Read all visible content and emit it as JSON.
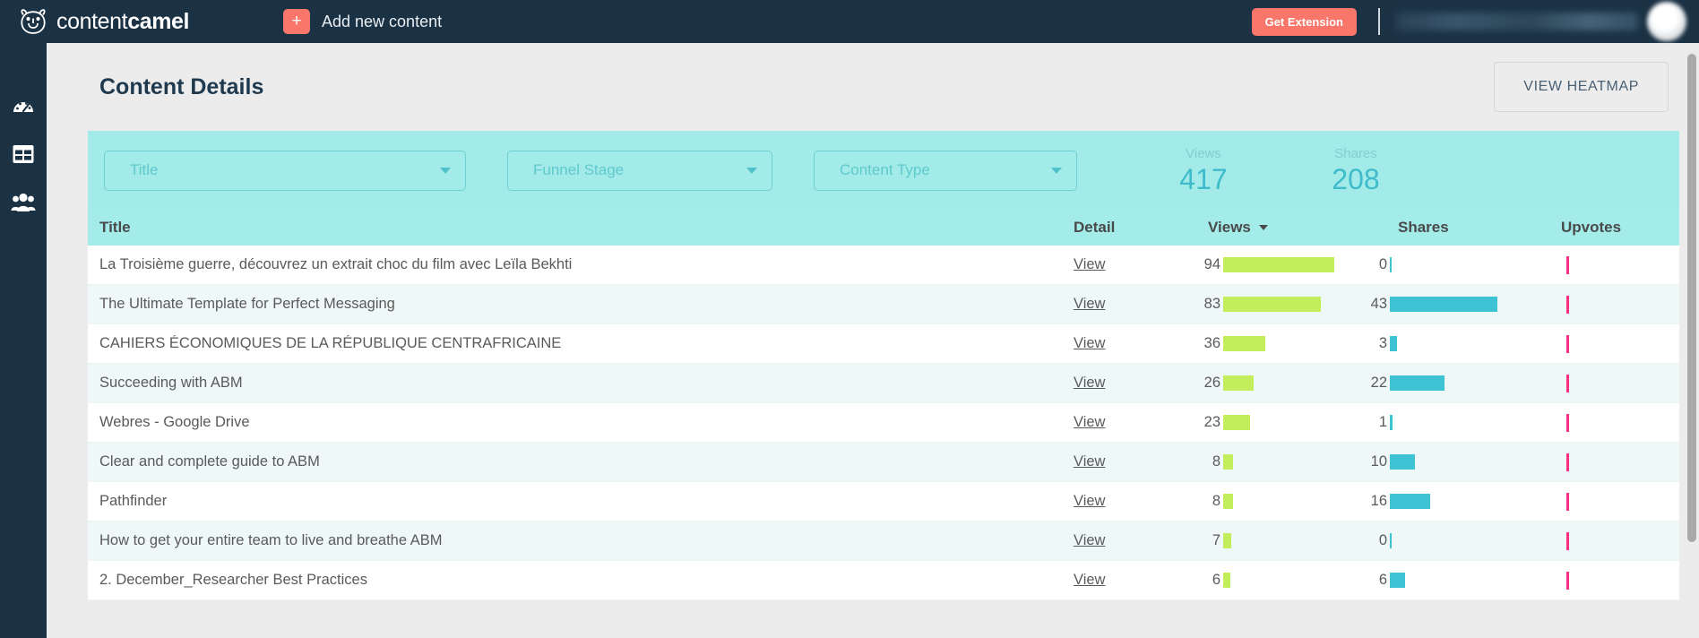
{
  "topnav": {
    "brand_light": "content",
    "brand_bold": "camel",
    "logo_icon": "camel-logo-icon",
    "add_new_label": "Add new content",
    "add_new_icon": "plus-icon",
    "get_extension_label": "Get Extension",
    "user_name": "",
    "avatar_icon": "avatar-icon",
    "colors": {
      "nav_background": "#1b3144",
      "accent_coral": "#f8766a"
    }
  },
  "sidebar": {
    "items": [
      {
        "name": "dashboard",
        "icon": "speedometer-icon"
      },
      {
        "name": "content",
        "icon": "grid-table-icon"
      },
      {
        "name": "team",
        "icon": "people-icon"
      }
    ]
  },
  "page": {
    "title": "Content Details",
    "heatmap_button": "VIEW HEATMAP"
  },
  "filters": {
    "title": {
      "label": "Title",
      "caret": "chevron-down-icon"
    },
    "funnel": {
      "label": "Funnel Stage",
      "caret": "chevron-down-icon"
    },
    "content_type": {
      "label": "Content Type",
      "caret": "chevron-down-icon"
    },
    "stats": [
      {
        "label": "Views",
        "value": "417"
      },
      {
        "label": "Shares",
        "value": "208"
      }
    ],
    "colors": {
      "filter_background": "#a3ebe8",
      "stat_value": "#3fbbcc"
    }
  },
  "table": {
    "headers": {
      "title": "Title",
      "detail": "Detail",
      "views": "Views",
      "shares": "Shares",
      "upvotes": "Upvotes"
    },
    "sort_column": "Views",
    "sort_icon": "sort-descending-caret-icon",
    "detail_link_label": "View",
    "rows": [
      {
        "title": "La Troisième guerre, découvrez un extrait choc du film avec Leïla Bekhti",
        "detail": "View",
        "views": "94",
        "shares": "0",
        "upvotes": "0"
      },
      {
        "title": "The Ultimate Template for Perfect Messaging",
        "detail": "View",
        "views": "83",
        "shares": "43",
        "upvotes": "0"
      },
      {
        "title": "CAHIERS ÉCONOMIQUES DE LA RÉPUBLIQUE CENTRAFRICAINE",
        "detail": "View",
        "views": "36",
        "shares": "3",
        "upvotes": "0"
      },
      {
        "title": "Succeeding with ABM",
        "detail": "View",
        "views": "26",
        "shares": "22",
        "upvotes": "0"
      },
      {
        "title": "Webres - Google Drive",
        "detail": "View",
        "views": "23",
        "shares": "1",
        "upvotes": "0"
      },
      {
        "title": "Clear and complete guide to ABM",
        "detail": "View",
        "views": "8",
        "shares": "10",
        "upvotes": "0"
      },
      {
        "title": "Pathfinder",
        "detail": "View",
        "views": "8",
        "shares": "16",
        "upvotes": "0"
      },
      {
        "title": "How to get your entire team to live and breathe ABM",
        "detail": "View",
        "views": "7",
        "shares": "0",
        "upvotes": "0"
      },
      {
        "title": "2. December_Researcher Best Practices",
        "detail": "View",
        "views": "6",
        "shares": "6",
        "upvotes": "0"
      }
    ]
  },
  "chart_data": {
    "type": "bar",
    "title": "Content Details",
    "categories": [
      "La Troisième guerre, découvrez un extrait choc du film avec Leïla Bekhti",
      "The Ultimate Template for Perfect Messaging",
      "CAHIERS ÉCONOMIQUES DE LA RÉPUBLIQUE CENTRAFRICAINE",
      "Succeeding with ABM",
      "Webres - Google Drive",
      "Clear and complete guide to ABM",
      "Pathfinder",
      "How to get your entire team to live and breathe ABM",
      "2. December_Researcher Best Practices"
    ],
    "series": [
      {
        "name": "Views",
        "values": [
          94,
          83,
          36,
          26,
          23,
          8,
          8,
          7,
          6
        ],
        "color": "#c3ee5c"
      },
      {
        "name": "Shares",
        "values": [
          0,
          43,
          3,
          22,
          1,
          10,
          16,
          0,
          6
        ],
        "color": "#3dc3d4"
      },
      {
        "name": "Upvotes",
        "values": [
          0,
          0,
          0,
          0,
          0,
          0,
          0,
          0,
          0
        ],
        "color": "#fa2f84"
      }
    ],
    "totals": {
      "Views": 417,
      "Shares": 208
    },
    "xlabel": "",
    "ylabel": "",
    "grid": false,
    "legend": "none",
    "orientation": "horizontal"
  },
  "scrollbar": {
    "position": "top"
  }
}
